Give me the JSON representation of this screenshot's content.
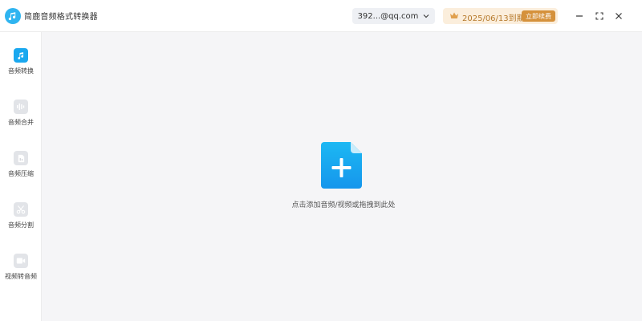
{
  "app": {
    "title": "简鹿音频格式转换器"
  },
  "header": {
    "account": "392...@qq.com",
    "vip_expiry": "2025/06/13到期",
    "renew_label": "立即续费"
  },
  "sidebar": {
    "items": [
      {
        "label": "音频转换",
        "icon": "music-note-icon",
        "active": true
      },
      {
        "label": "音频合并",
        "icon": "waveform-icon",
        "active": false
      },
      {
        "label": "音频压缩",
        "icon": "compress-icon",
        "active": false
      },
      {
        "label": "音频分割",
        "icon": "scissors-icon",
        "active": false
      },
      {
        "label": "视频转音频",
        "icon": "video-icon",
        "active": false
      }
    ]
  },
  "main": {
    "drop_hint": "点击添加音频/视频或拖拽到此处"
  },
  "colors": {
    "accent": "#1aa8ef",
    "vip_bg": "#fbeedc",
    "vip_text": "#b67a2c",
    "renew_bg": "#d5913b"
  }
}
